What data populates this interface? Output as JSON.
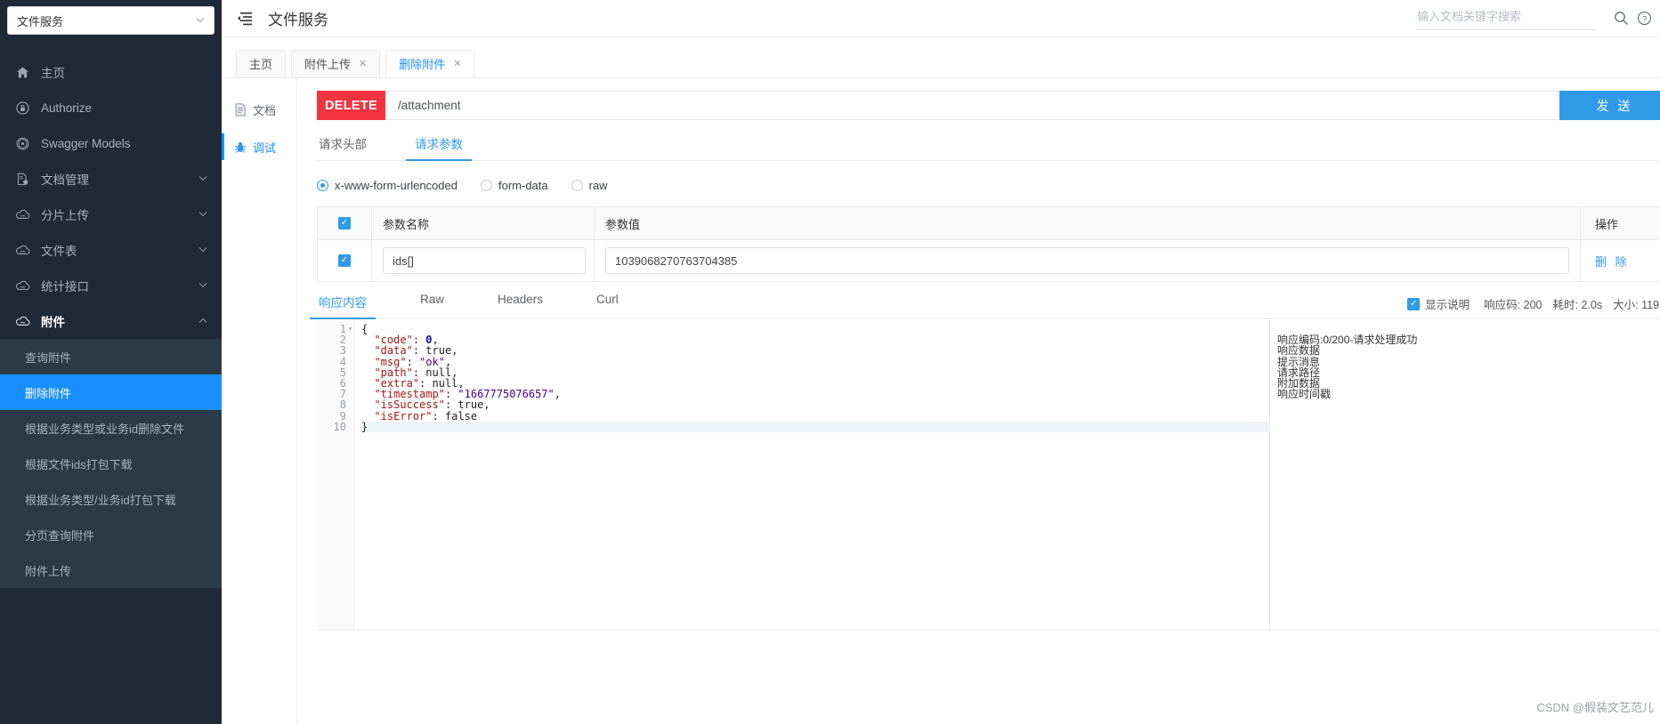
{
  "sidebar": {
    "project_select": {
      "value": "文件服务",
      "caret": "chevron-down-icon"
    },
    "items": [
      {
        "label": "主页",
        "icon": "home-icon",
        "arrow": ""
      },
      {
        "label": "Authorize",
        "icon": "lock-icon",
        "arrow": ""
      },
      {
        "label": "Swagger Models",
        "icon": "model-icon",
        "arrow": ""
      },
      {
        "label": "文档管理",
        "icon": "doc-manage-icon",
        "arrow": "⌄"
      },
      {
        "label": "分片上传",
        "icon": "cloud-icon",
        "arrow": "⌄"
      },
      {
        "label": "文件表",
        "icon": "cloud-icon",
        "arrow": "⌄"
      },
      {
        "label": "统计接口",
        "icon": "cloud-icon",
        "arrow": "⌄"
      },
      {
        "label": "附件",
        "icon": "cloud-icon",
        "arrow": "⌃",
        "open": true
      }
    ],
    "sub_items": [
      {
        "label": "查询附件",
        "active": false
      },
      {
        "label": "删除附件",
        "active": true
      },
      {
        "label": "根据业务类型或业务id删除文件",
        "active": false
      },
      {
        "label": "根据文件ids打包下载",
        "active": false
      },
      {
        "label": "根据业务类型/业务id打包下载",
        "active": false
      },
      {
        "label": "分页查询附件",
        "active": false
      },
      {
        "label": "附件上传",
        "active": false
      }
    ]
  },
  "header": {
    "collapse_icon": "menu-fold-icon",
    "title": "文件服务",
    "search_placeholder": "输入文档关键字搜索",
    "search_value": "",
    "search_icon": "search-icon",
    "help_icon": "question-circle-icon"
  },
  "tabs": [
    {
      "label": "主页",
      "closable": false,
      "active": false
    },
    {
      "label": "附件上传",
      "closable": true,
      "active": false
    },
    {
      "label": "删除附件",
      "closable": true,
      "active": true
    }
  ],
  "subnav": [
    {
      "label": "文档",
      "icon": "document-icon",
      "active": false
    },
    {
      "label": "调试",
      "icon": "bug-icon",
      "active": true
    }
  ],
  "request": {
    "method": "DELETE",
    "url": "/attachment",
    "send_label": "发 送",
    "tabs": [
      {
        "label": "请求头部",
        "active": false
      },
      {
        "label": "请求参数",
        "active": true
      }
    ],
    "body_types": [
      {
        "label": "x-www-form-urlencoded",
        "selected": true
      },
      {
        "label": "form-data",
        "selected": false
      },
      {
        "label": "raw",
        "selected": false
      }
    ],
    "param_table": {
      "headers": {
        "name": "参数名称",
        "value": "参数值",
        "op": "操作"
      },
      "rows": [
        {
          "checked": true,
          "name": "ids[]",
          "value": "1039068270763704385",
          "op": "删 除"
        }
      ]
    }
  },
  "response": {
    "tabs": [
      {
        "label": "响应内容",
        "active": true
      },
      {
        "label": "Raw",
        "active": false
      },
      {
        "label": "Headers",
        "active": false
      },
      {
        "label": "Curl",
        "active": false
      }
    ],
    "show_desc_label": "显示说明",
    "show_desc_checked": true,
    "status_code_label": "响应码:",
    "status_code": "200",
    "time_label": "耗时:",
    "time_value": "2.0s",
    "size_label": "大小:",
    "size_value": "119",
    "line_numbers": [
      "1",
      "2",
      "3",
      "4",
      "5",
      "6",
      "7",
      "8",
      "9",
      "10"
    ],
    "code_lines": [
      {
        "indent": 0,
        "parts": [
          {
            "t": "{",
            "c": "b"
          }
        ]
      },
      {
        "indent": 1,
        "parts": [
          {
            "t": "\"code\"",
            "c": "k"
          },
          {
            "t": ": ",
            "c": "b"
          },
          {
            "t": "0",
            "c": "n"
          },
          {
            "t": ",",
            "c": "b"
          }
        ]
      },
      {
        "indent": 1,
        "parts": [
          {
            "t": "\"data\"",
            "c": "k"
          },
          {
            "t": ": ",
            "c": "b"
          },
          {
            "t": "true",
            "c": "b"
          },
          {
            "t": ",",
            "c": "b"
          }
        ]
      },
      {
        "indent": 1,
        "parts": [
          {
            "t": "\"msg\"",
            "c": "k"
          },
          {
            "t": ": ",
            "c": "b"
          },
          {
            "t": "\"ok\"",
            "c": "s"
          },
          {
            "t": ",",
            "c": "b"
          }
        ]
      },
      {
        "indent": 1,
        "parts": [
          {
            "t": "\"path\"",
            "c": "k"
          },
          {
            "t": ": ",
            "c": "b"
          },
          {
            "t": "null",
            "c": "b"
          },
          {
            "t": ",",
            "c": "b"
          }
        ]
      },
      {
        "indent": 1,
        "parts": [
          {
            "t": "\"extra\"",
            "c": "k"
          },
          {
            "t": ": ",
            "c": "b"
          },
          {
            "t": "null",
            "c": "b"
          },
          {
            "t": ",",
            "c": "b"
          }
        ]
      },
      {
        "indent": 1,
        "parts": [
          {
            "t": "\"timestamp\"",
            "c": "k"
          },
          {
            "t": ": ",
            "c": "b"
          },
          {
            "t": "\"1667775076657\"",
            "c": "s"
          },
          {
            "t": ",",
            "c": "b"
          }
        ]
      },
      {
        "indent": 1,
        "parts": [
          {
            "t": "\"isSuccess\"",
            "c": "k"
          },
          {
            "t": ": ",
            "c": "b"
          },
          {
            "t": "true",
            "c": "b"
          },
          {
            "t": ",",
            "c": "b"
          }
        ]
      },
      {
        "indent": 1,
        "parts": [
          {
            "t": "\"isError\"",
            "c": "k"
          },
          {
            "t": ": ",
            "c": "b"
          },
          {
            "t": "false",
            "c": "b"
          }
        ]
      },
      {
        "indent": 0,
        "parts": [
          {
            "t": "}",
            "c": "b"
          }
        ]
      }
    ],
    "annotations": [
      "",
      "响应编码:0/200-请求处理成功",
      "响应数据",
      "提示消息",
      "请求路径",
      "附加数据",
      "响应时间戳",
      "",
      "",
      ""
    ]
  },
  "watermark": "CSDN @假装文艺范儿",
  "colors": {
    "accent": "#2f9ae8",
    "sidebar_bg": "#1f2937",
    "sidebar_sub_bg": "#2c3a47",
    "active_blue": "#1890ff",
    "delete_red": "#f5333f"
  }
}
